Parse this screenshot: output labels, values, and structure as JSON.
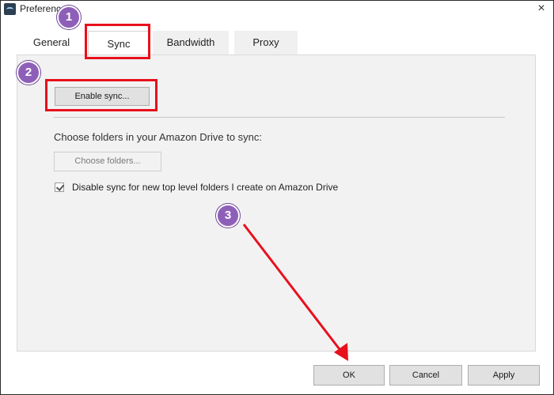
{
  "window": {
    "title": "Preferences",
    "close_glyph": "×"
  },
  "tabs": [
    {
      "label": "General"
    },
    {
      "label": "Sync"
    },
    {
      "label": "Bandwidth"
    },
    {
      "label": "Proxy"
    }
  ],
  "sync": {
    "enable_button": "Enable sync...",
    "choose_label": "Choose folders in your Amazon Drive to sync:",
    "choose_button": "Choose folders...",
    "disable_new_folders_label": "Disable sync for new top level folders I create on Amazon Drive",
    "disable_new_folders_checked": true
  },
  "footer": {
    "ok": "OK",
    "cancel": "Cancel",
    "apply": "Apply"
  },
  "annotations": {
    "step1": "1",
    "step2": "2",
    "step3": "3",
    "highlight_color": "#e8101c",
    "badge_color": "#8e5fb8"
  }
}
